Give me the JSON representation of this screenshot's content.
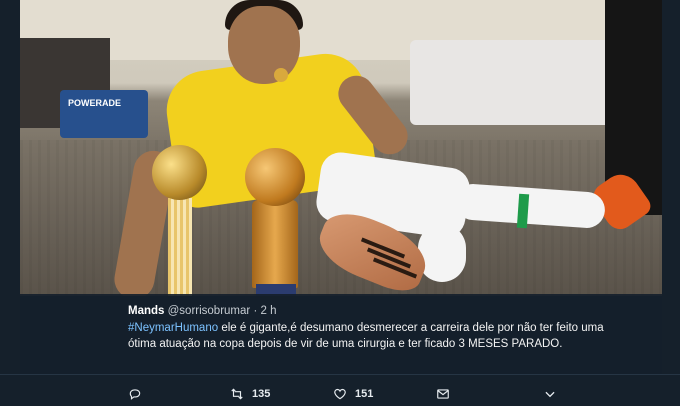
{
  "tweet": {
    "author_name": "Mands",
    "handle": "@sorrisobrumar",
    "separator": "·",
    "time": "2 h",
    "hashtag": "#NeymarHumano",
    "text": " ele é gigante,é desumano desmerecer a carreira dele por não ter feito uma ótima atuação na copa depois de vir de uma cirurgia e ter ficado 3 MESES PARADO."
  },
  "photo": {
    "cooler_label": "POWERADE"
  },
  "actions": {
    "reply_count": "",
    "retweet_count": "135",
    "like_count": "151"
  },
  "colors": {
    "background": "#15202b",
    "text": "#ffffff",
    "secondary_text": "#c6ccd2",
    "hashtag": "#7cc2ff"
  },
  "icons": [
    "reply-icon",
    "retweet-icon",
    "like-icon",
    "message-icon",
    "chevron-down-icon"
  ]
}
